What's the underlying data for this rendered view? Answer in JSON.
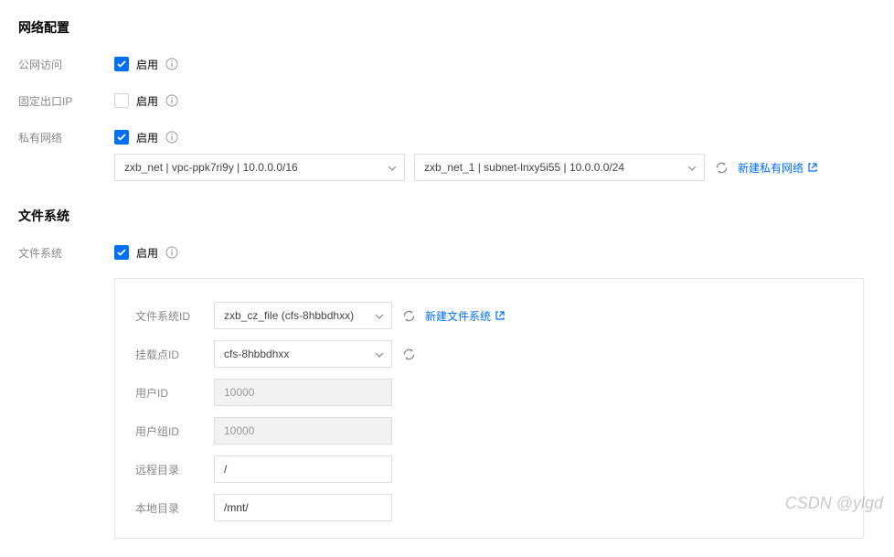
{
  "network": {
    "section_title": "网络配置",
    "public_access": {
      "label": "公网访问",
      "enable": "启用",
      "checked": true
    },
    "fixed_export_ip": {
      "label": "固定出口IP",
      "enable": "启用",
      "checked": false
    },
    "private_network": {
      "label": "私有网络",
      "enable": "启用",
      "checked": true
    },
    "vpc_select": "zxb_net | vpc-ppk7ri9y | 10.0.0.0/16",
    "subnet_select": "zxb_net_1 | subnet-lnxy5i55 | 10.0.0.0/24",
    "new_vpc_link": "新建私有网络"
  },
  "file_system": {
    "section_title": "文件系统",
    "fs": {
      "label": "文件系统",
      "enable": "启用",
      "checked": true
    },
    "panel": {
      "fs_id_label": "文件系统ID",
      "fs_id_value": "zxb_cz_file (cfs-8hbbdhxx)",
      "new_fs_link": "新建文件系统",
      "mount_id_label": "挂载点ID",
      "mount_id_value": "cfs-8hbbdhxx",
      "user_id_label": "用户ID",
      "user_id_value": "10000",
      "group_id_label": "用户组ID",
      "group_id_value": "10000",
      "remote_dir_label": "远程目录",
      "remote_dir_value": "/",
      "local_dir_label": "本地目录",
      "local_dir_value": "/mnt/"
    }
  },
  "watermark": "CSDN @ylgd"
}
